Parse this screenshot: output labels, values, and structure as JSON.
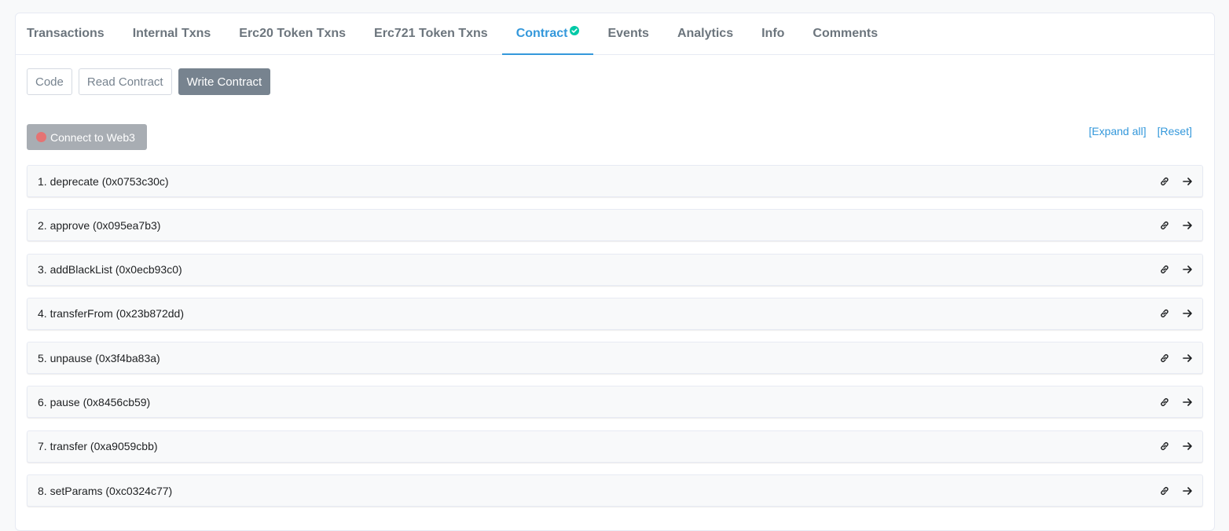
{
  "tabs": [
    {
      "label": "Transactions"
    },
    {
      "label": "Internal Txns"
    },
    {
      "label": "Erc20 Token Txns"
    },
    {
      "label": "Erc721 Token Txns"
    },
    {
      "label": "Contract",
      "active": true,
      "icon": "check-circle-icon"
    },
    {
      "label": "Events"
    },
    {
      "label": "Analytics"
    },
    {
      "label": "Info"
    },
    {
      "label": "Comments"
    }
  ],
  "subtabs": [
    {
      "label": "Code"
    },
    {
      "label": "Read Contract"
    },
    {
      "label": "Write Contract",
      "active": true
    }
  ],
  "connect_button": {
    "label": "Connect to Web3",
    "status_color": "#e57373"
  },
  "links": {
    "expand_all": "[Expand all]",
    "reset": "[Reset]"
  },
  "functions": [
    {
      "label": "1. deprecate (0x0753c30c)"
    },
    {
      "label": "2. approve (0x095ea7b3)"
    },
    {
      "label": "3. addBlackList (0x0ecb93c0)"
    },
    {
      "label": "4. transferFrom (0x23b872dd)"
    },
    {
      "label": "5. unpause (0x3f4ba83a)"
    },
    {
      "label": "6. pause (0x8456cb59)"
    },
    {
      "label": "7. transfer (0xa9059cbb)"
    },
    {
      "label": "8. setParams (0xc0324c77)"
    }
  ],
  "colors": {
    "accent": "#3498db",
    "active_subtab": "#77838f",
    "verified": "#00c9a7"
  }
}
